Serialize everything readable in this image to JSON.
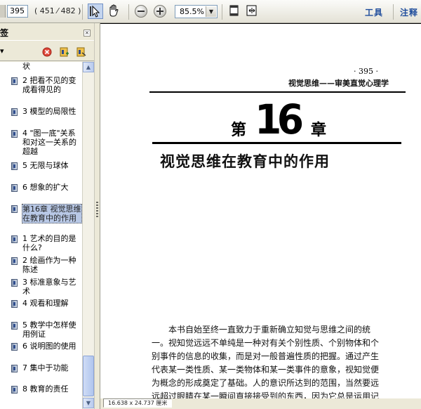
{
  "toolbar": {
    "page_input_value": "395",
    "page_count": "( 451 ⁄ 482 )",
    "zoom_value": "85.5%",
    "tools_label": "工具",
    "comment_label": "注释"
  },
  "panel": {
    "title": "签",
    "options_label": "▾",
    "bookmarks": [
      {
        "label": "状"
      },
      {
        "label": "2 把看不见的变成看得见的"
      },
      {
        "label": "3 模型的局限性"
      },
      {
        "label": "4 \"图一底\"关系和对这一关系的超越"
      },
      {
        "label": "5 无限与球体"
      },
      {
        "label": "6 想象的扩大"
      },
      {
        "label": "第16章 视觉思维在教育中的作用"
      },
      {
        "label": "1 艺术的目的是什么?"
      },
      {
        "label": "2 绘画作为一种陈述"
      },
      {
        "label": "3 标准意象与艺术"
      },
      {
        "label": "4 观看和理解"
      },
      {
        "label": "5 教学中怎样使用例证"
      },
      {
        "label": "6 说明图的使用"
      },
      {
        "label": "7 集中于功能"
      },
      {
        "label": "8 教育的责任"
      }
    ]
  },
  "document": {
    "page_number": "· 395 ·",
    "running_head": "视觉思维——审美直觉心理学",
    "chapter_prefix": "第",
    "chapter_number": "16",
    "chapter_suffix": "章",
    "chapter_title": "视觉思维在教育中的作用",
    "body_lines": [
      "　　本书自始至终一直致力于重新确立知觉与思维之间的统",
      "一。视知觉远远不单纯是一种对有关个别性质、个别物体和个",
      "别事件的信息的收集，而是对一般普遍性质的把握。通过产生",
      "代表某一类性质、某一类物体和某一类事件的意象，视知觉便",
      "为概念的形成奠定了基础。人的意识所达到的范围，当然要远",
      "远超过眼睛在某一瞬间直接接受到的东西，因为它总是运用记"
    ]
  },
  "status": {
    "page_size": "16.638 x 24.737 厘米"
  }
}
